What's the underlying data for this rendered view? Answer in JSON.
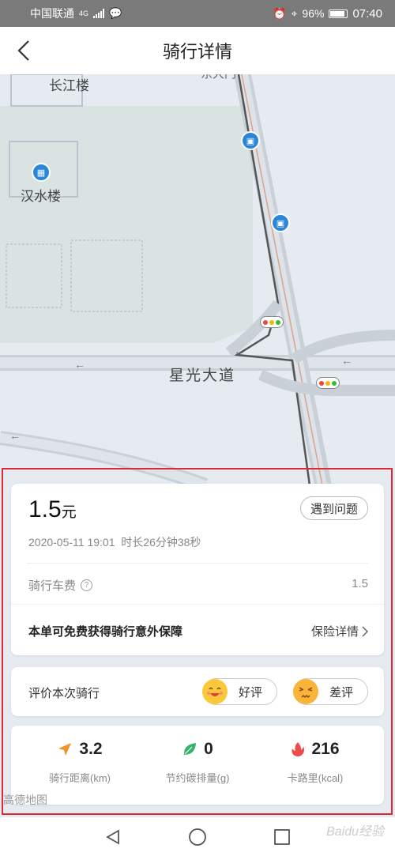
{
  "status_bar": {
    "carrier": "中国联通",
    "net": "4G",
    "battery": "96%",
    "time": "07:40"
  },
  "nav": {
    "title": "骑行详情"
  },
  "map": {
    "labels": {
      "building_1": "长江楼",
      "building_2": "汉水楼",
      "road": "星光大道",
      "top_fragment": "东大门"
    },
    "logo": "高德地图"
  },
  "ride": {
    "price": "1.5",
    "price_unit": "元",
    "problem_button": "遇到问题",
    "datetime": "2020-05-11 19:01",
    "duration": "时长26分钟38秒",
    "fee_label": "骑行车费",
    "fee_value": "1.5",
    "insurance_text": "本单可免费获得骑行意外保障",
    "insurance_link": "保险详情"
  },
  "rating": {
    "label": "评价本次骑行",
    "good": "好评",
    "bad": "差评"
  },
  "stats": [
    {
      "value": "3.2",
      "label": "骑行距离(km)",
      "icon": "navigation-arrow-icon",
      "color": "#f0932b"
    },
    {
      "value": "0",
      "label": "节约碳排量(g)",
      "icon": "leaf-icon",
      "color": "#34b26a"
    },
    {
      "value": "216",
      "label": "卡路里(kcal)",
      "icon": "flame-icon",
      "color": "#ef4b4b"
    }
  ],
  "watermark": "Baidu经验",
  "colors": {
    "highlight_frame": "#d92a35",
    "poi_blue": "#2a86d8"
  }
}
